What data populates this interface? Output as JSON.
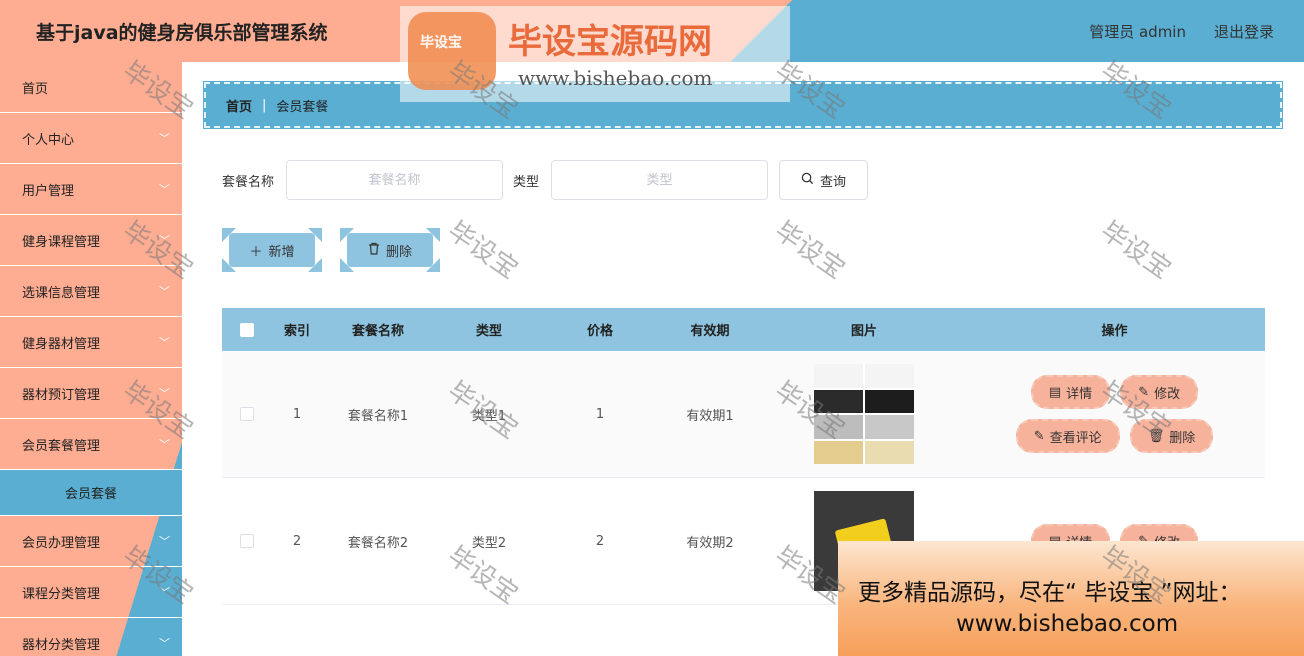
{
  "header": {
    "title": "基于java的健身房俱乐部管理系统",
    "user": "管理员 admin",
    "logout": "退出登录"
  },
  "sidebar": {
    "items": [
      {
        "label": "首页",
        "chevron": false
      },
      {
        "label": "个人中心",
        "chevron": true
      },
      {
        "label": "用户管理",
        "chevron": true
      },
      {
        "label": "健身课程管理",
        "chevron": true
      },
      {
        "label": "选课信息管理",
        "chevron": true
      },
      {
        "label": "健身器材管理",
        "chevron": true
      },
      {
        "label": "器材预订管理",
        "chevron": true
      },
      {
        "label": "会员套餐管理",
        "chevron": true
      }
    ],
    "active_sub": "会员套餐",
    "items_after": [
      {
        "label": "会员办理管理",
        "chevron": true
      },
      {
        "label": "课程分类管理",
        "chevron": true
      },
      {
        "label": "器材分类管理",
        "chevron": true
      }
    ]
  },
  "breadcrumb": {
    "home": "首页",
    "separator": "|",
    "current": "会员套餐"
  },
  "search": {
    "name_label": "套餐名称",
    "name_placeholder": "套餐名称",
    "type_label": "类型",
    "type_placeholder": "类型",
    "query_label": "查询"
  },
  "actions": {
    "add_label": "新增",
    "delete_label": "删除"
  },
  "table": {
    "headers": {
      "index": "索引",
      "name": "套餐名称",
      "type": "类型",
      "price": "价格",
      "validity": "有效期",
      "image": "图片",
      "ops": "操作"
    },
    "rows": [
      {
        "index": "1",
        "name": "套餐名称1",
        "type": "类型1",
        "price": "1",
        "validity": "有效期1"
      },
      {
        "index": "2",
        "name": "套餐名称2",
        "type": "类型2",
        "price": "2",
        "validity": "有效期2"
      }
    ],
    "ops": {
      "detail": "详情",
      "edit": "修改",
      "review": "查看评论",
      "delete": "删除"
    }
  },
  "watermark": {
    "text": "毕设宝",
    "logo_badge": "毕设宝",
    "logo_text": "毕设宝源码网",
    "logo_url": "www.bishebao.com"
  },
  "banner": {
    "line1": "更多精品源码，尽在“ 毕设宝 ”网址：",
    "line2": "www.bishebao.com"
  },
  "colors": {
    "salmon": "#ffad92",
    "blue": "#5aaed1",
    "light_blue": "#8ec4df",
    "op_button": "#f7b29b"
  }
}
